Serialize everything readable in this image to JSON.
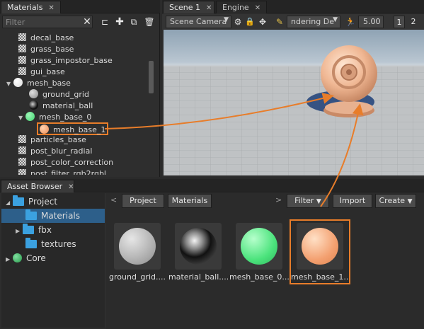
{
  "materials_panel": {
    "tab_label": "Materials",
    "filter_placeholder": "Filter",
    "tree": [
      {
        "label": "decal_base"
      },
      {
        "label": "grass_base"
      },
      {
        "label": "grass_impostor_base"
      },
      {
        "label": "gui_base"
      },
      {
        "label": "mesh_base"
      },
      {
        "label": "ground_grid"
      },
      {
        "label": "material_ball"
      },
      {
        "label": "mesh_base_0"
      },
      {
        "label": "mesh_base_1"
      },
      {
        "label": "particles_base"
      },
      {
        "label": "post_blur_radial"
      },
      {
        "label": "post_color_correction"
      },
      {
        "label": "post_filter_rgb2rgbl"
      }
    ]
  },
  "scene_panel": {
    "tab_scene": "Scene 1",
    "tab_engine": "Engine",
    "camera_combo": "Scene Camera",
    "render_combo": "ndering De",
    "speed_value": "5.00",
    "page_1": "1",
    "page_2": "2"
  },
  "asset_browser": {
    "tab_label": "Asset Browser",
    "tree": [
      {
        "label": "Project"
      },
      {
        "label": "Materials"
      },
      {
        "label": "fbx"
      },
      {
        "label": "textures"
      },
      {
        "label": "Core"
      }
    ],
    "breadcrumb": [
      "Project",
      "Materials"
    ],
    "filter_label": "Filter",
    "import_label": "Import",
    "create_label": "Create",
    "assets": [
      {
        "label": "ground_grid....",
        "color": "#bdbdbd"
      },
      {
        "label": "material_ball....",
        "color": "#1a1a1a"
      },
      {
        "label": "mesh_base_0....",
        "color": "#4be37c"
      },
      {
        "label": "mesh_base_1....",
        "color": "#f3a070"
      }
    ]
  },
  "colors": {
    "highlight": "#e87d2a",
    "selection": "#2d5f8a",
    "folder": "#3ba1e0"
  }
}
